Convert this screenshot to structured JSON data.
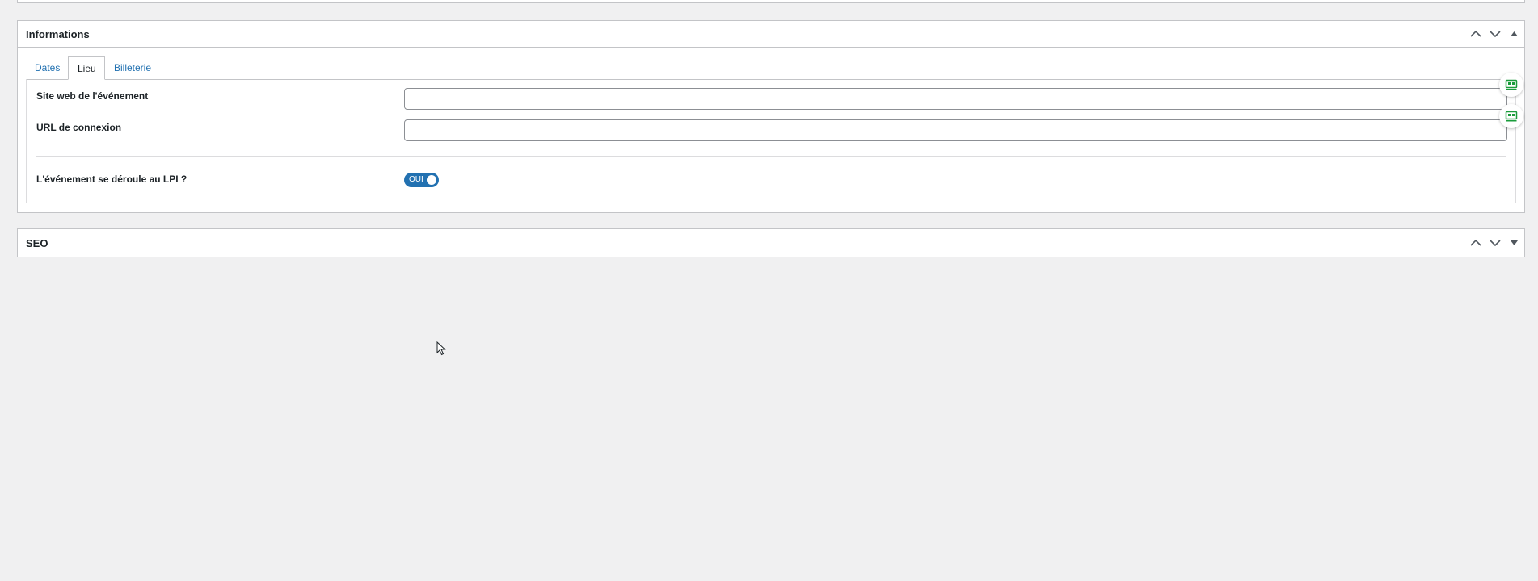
{
  "boxes": {
    "informations": {
      "title": "Informations",
      "tabs": [
        {
          "label": "Dates",
          "active": false
        },
        {
          "label": "Lieu",
          "active": true
        },
        {
          "label": "Billeterie",
          "active": false
        }
      ],
      "fields": {
        "website": {
          "label": "Site web de l'événement",
          "value": ""
        },
        "connection_url": {
          "label": "URL de connexion",
          "value": ""
        },
        "at_lpi": {
          "label": "L'événement se déroule au LPI ?",
          "toggle_text": "OUI",
          "checked": true
        }
      }
    },
    "seo": {
      "title": "SEO"
    }
  },
  "icons": {
    "move_up": "chevron-up-icon",
    "move_down": "chevron-down-icon",
    "collapse": "triangle-up-icon",
    "expand": "triangle-down-icon",
    "field_widget": "contact-card-icon",
    "cursor": "mouse-pointer-icon"
  },
  "colors": {
    "accent": "#2271b1",
    "widget_icon": "#1a9c3b",
    "background": "#f0f0f1",
    "border": "#c3c4c7"
  }
}
